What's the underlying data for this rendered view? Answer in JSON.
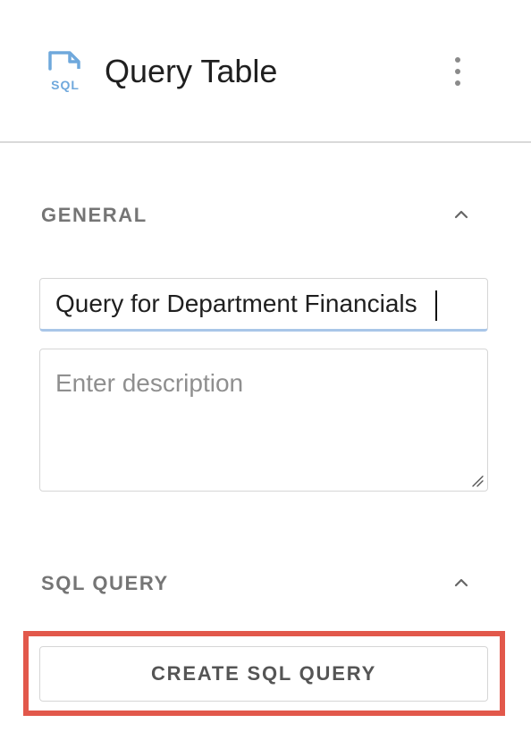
{
  "header": {
    "title": "Query Table",
    "icon": "sql-file-icon",
    "icon_text": "SQL",
    "menu_icon": "more-vertical-icon"
  },
  "general": {
    "section_title": "GENERAL",
    "collapse_icon": "chevron-up-icon",
    "name_value": "Query for Department Financials",
    "description_placeholder": "Enter description",
    "description_value": ""
  },
  "sql_query": {
    "section_title": "SQL QUERY",
    "collapse_icon": "chevron-up-icon",
    "create_button_label": "CREATE SQL QUERY"
  },
  "colors": {
    "accent_blue": "#6fa8dc",
    "focus_underline": "#a9c6e8",
    "highlight_red": "#e2584b",
    "section_text": "#757575"
  }
}
